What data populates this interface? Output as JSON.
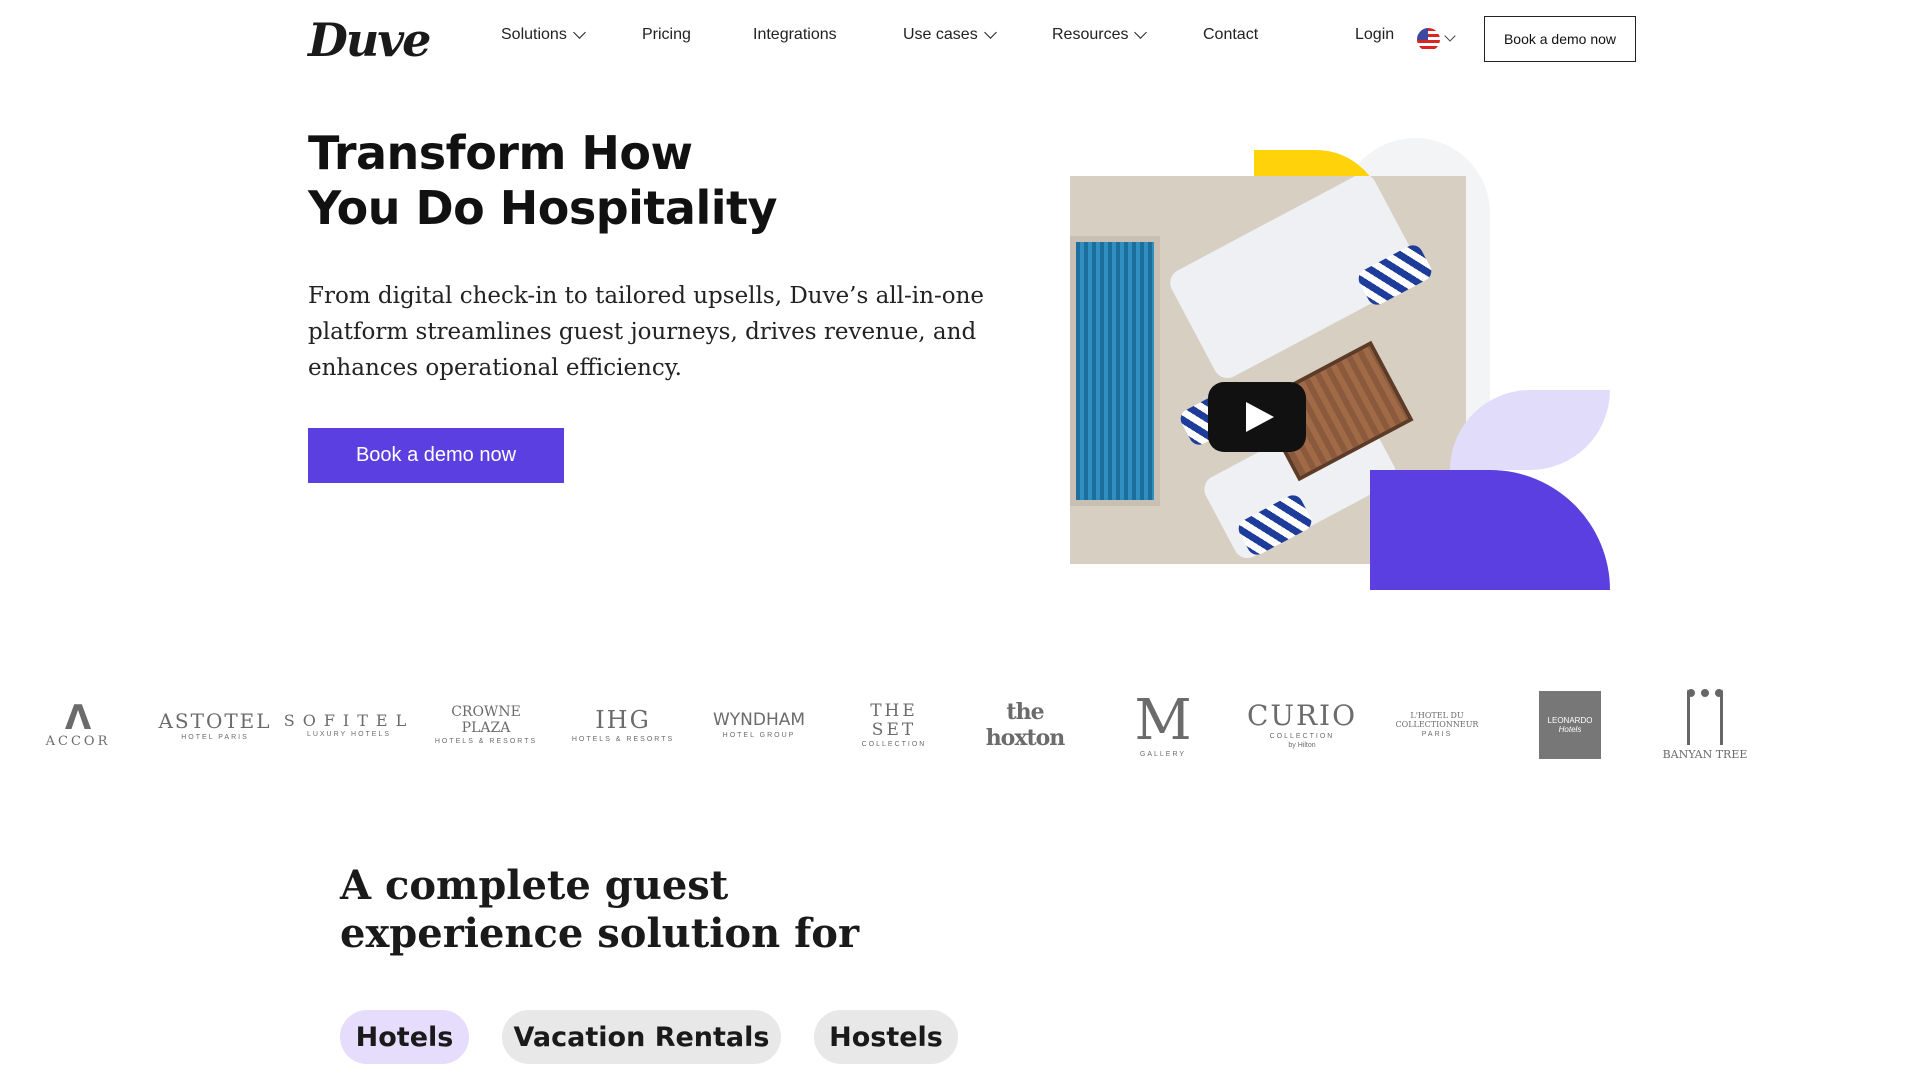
{
  "nav": {
    "logo": "Duve",
    "links": [
      {
        "label": "Solutions",
        "dropdown": true
      },
      {
        "label": "Pricing",
        "dropdown": false
      },
      {
        "label": "Integrations",
        "dropdown": false
      },
      {
        "label": "Use cases",
        "dropdown": true
      },
      {
        "label": "Resources",
        "dropdown": true
      },
      {
        "label": "Contact",
        "dropdown": false
      }
    ],
    "login": "Login",
    "language_icon": "us-flag-icon",
    "cta": "Book a demo now"
  },
  "hero": {
    "title_line1": "Transform How",
    "title_line2": "You Do Hospitality",
    "subtitle": "From digital check-in to tailored upsells, Duve’s all-in-one platform streamlines guest journeys, drives revenue, and enhances operational efficiency.",
    "cta": "Book a demo now",
    "media_icon": "play-icon"
  },
  "logos": [
    {
      "name": "ACCOR"
    },
    {
      "name": "ASTOTEL",
      "tagline": "HOTEL  PARIS"
    },
    {
      "name": "SOFITEL",
      "tagline": "LUXURY HOTELS"
    },
    {
      "name": "CROWNE PLAZA",
      "tagline": "HOTELS & RESORTS"
    },
    {
      "name": "IHG",
      "tagline": "HOTELS & RESORTS"
    },
    {
      "name": "WYNDHAM",
      "tagline": "HOTEL GROUP"
    },
    {
      "name": "THE SET",
      "tagline": "COLLECTION"
    },
    {
      "name": "the hoxton"
    },
    {
      "name": "GALLERY"
    },
    {
      "name": "CURIO",
      "tagline": "COLLECTION",
      "sub": "by Hilton"
    },
    {
      "name": "L'HOTEL DU COLLECTIONNEUR",
      "tagline": "PARIS"
    },
    {
      "name": "LEONARDO",
      "tagline": "Hotels"
    },
    {
      "name": "BANYAN TREE"
    }
  ],
  "section": {
    "title_line1": "A complete guest",
    "title_line2": "experience solution for",
    "tabs": [
      {
        "label": "Hotels",
        "active": true
      },
      {
        "label": "Vacation Rentals",
        "active": false
      },
      {
        "label": "Hostels",
        "active": false
      }
    ]
  },
  "colors": {
    "accent": "#5b3fe0",
    "yellow": "#ffd20a",
    "lavender": "#e2dcfb",
    "tab_active": "#e6dcfb",
    "tab_inactive": "#e8e8e8"
  }
}
